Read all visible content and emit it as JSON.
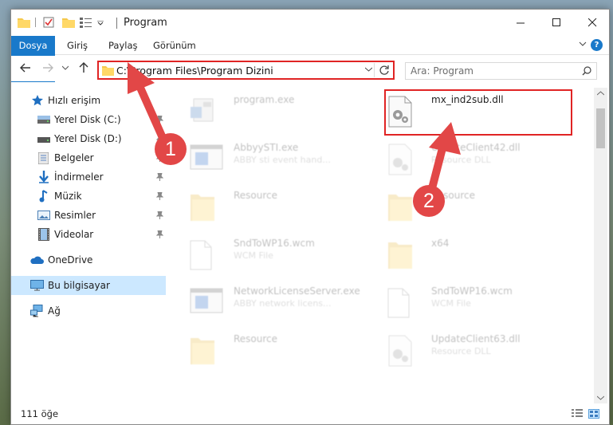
{
  "window": {
    "title": "Program"
  },
  "ribbon": {
    "tabs": [
      "Dosya",
      "Giriş",
      "Paylaş",
      "Görünüm"
    ]
  },
  "address_bar": {
    "path": "C:\\Program Files\\Program Dizini"
  },
  "search": {
    "placeholder": "Ara: Program"
  },
  "sidebar": {
    "items": [
      {
        "label": "Hızlı erişim",
        "icon": "star-icon"
      },
      {
        "label": "Yerel Disk (C:)",
        "icon": "drive-icon"
      },
      {
        "label": "Yerel Disk (D:)",
        "icon": "drive-icon"
      },
      {
        "label": "Belgeler",
        "icon": "documents-icon"
      },
      {
        "label": "İndirmeler",
        "icon": "download-icon"
      },
      {
        "label": "Müzik",
        "icon": "music-icon"
      },
      {
        "label": "Resimler",
        "icon": "pictures-icon"
      },
      {
        "label": "Videolar",
        "icon": "video-icon"
      },
      {
        "label": "OneDrive",
        "icon": "cloud-icon"
      },
      {
        "label": "Bu bilgisayar",
        "icon": "computer-icon"
      },
      {
        "label": "Ağ",
        "icon": "network-icon"
      }
    ]
  },
  "files": {
    "left": [
      {
        "name": "program.exe",
        "desc": "",
        "icon": "exe-icon"
      },
      {
        "name": "AbbyySTI.exe",
        "desc": "ABBY sti event hand...",
        "icon": "exe-icon"
      },
      {
        "name": "Resource",
        "desc": "",
        "icon": "folder-icon"
      },
      {
        "name": "SndToWP16.wcm",
        "desc": "WCM File",
        "icon": "file-icon"
      },
      {
        "name": "NetworkLicenseServer.exe",
        "desc": "ABBY network licens...",
        "icon": "exe-icon"
      },
      {
        "name": "Resource",
        "desc": "",
        "icon": "folder-icon"
      }
    ],
    "right": [
      {
        "name": "mx_ind2sub.dll",
        "desc": "",
        "icon": "dll-gear-icon"
      },
      {
        "name": "UpdateClient42.dll",
        "desc": "Resource DLL",
        "icon": "dll-gear-icon"
      },
      {
        "name": "Resource",
        "desc": "",
        "icon": "folder-icon"
      },
      {
        "name": "x64",
        "desc": "",
        "icon": "folder-icon"
      },
      {
        "name": "SndToWP16.wcm",
        "desc": "WCM File",
        "icon": "file-icon"
      },
      {
        "name": "UpdateClient63.dll",
        "desc": "Resource DLL",
        "icon": "dll-gear-icon"
      }
    ]
  },
  "status": {
    "count": "111 öğe"
  },
  "annotations": {
    "badge1": "1",
    "badge2": "2",
    "color": "#e24747"
  }
}
